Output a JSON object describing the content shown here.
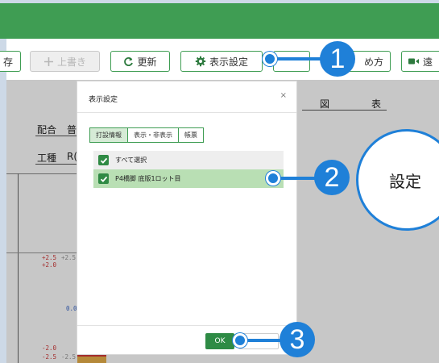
{
  "toolbar": {
    "left_partial_label": "存",
    "overwrite_label": "上書き",
    "refresh_label": "更新",
    "display_settings_label": "表示設定",
    "partial_hidden_label": "",
    "howto_label": "め方",
    "video_label": "遠"
  },
  "background": {
    "zu_label": "図",
    "hyo_label": "表",
    "row1_left": "配合",
    "row1_right": "普",
    "row2_left": "工種",
    "row2_right": "R(",
    "axis": {
      "pos_red": "+2.5",
      "pos_gray": "+2.5",
      "pos_red2": "+2.0",
      "zero": "0.0",
      "neg_red": "-2.0",
      "neg_red2": "-2.5",
      "neg_gray": "-2.5"
    }
  },
  "dialog": {
    "title": "表示設定",
    "close_glyph": "×",
    "tabs": [
      "打設情報",
      "表示・非表示",
      "帳票"
    ],
    "items": [
      {
        "label": "すべて選択",
        "checked": true
      },
      {
        "label": "P4橋脚 底版1ロット目",
        "checked": true
      }
    ],
    "ok_label": "OK"
  },
  "markers": {
    "one": "1",
    "two": "2",
    "three": "3"
  },
  "callout": {
    "text": "設定"
  },
  "colors": {
    "header_green": "#3f9d53",
    "marker_blue": "#1f80d8",
    "checkbox_green": "#2f8a44",
    "selected_row": "#b9dfb4"
  }
}
